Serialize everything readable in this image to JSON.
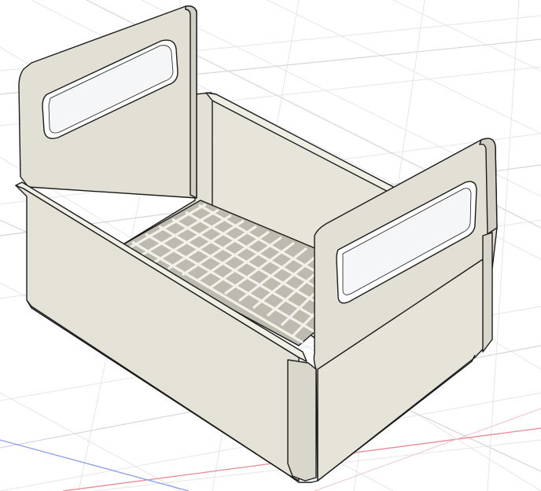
{
  "viewport": {
    "background": "#ffffff",
    "grid_minor_color": "#e9ebef",
    "grid_major_color": "#d4d8de",
    "axis_red": "#e8898f",
    "axis_blue": "#8a9ee6"
  },
  "model": {
    "name": "basket",
    "body_color": "#e6e4d8",
    "shade_color": "#d6d4c8",
    "dark_color": "#c8c6ba",
    "edge_color": "#1a1a1a"
  }
}
